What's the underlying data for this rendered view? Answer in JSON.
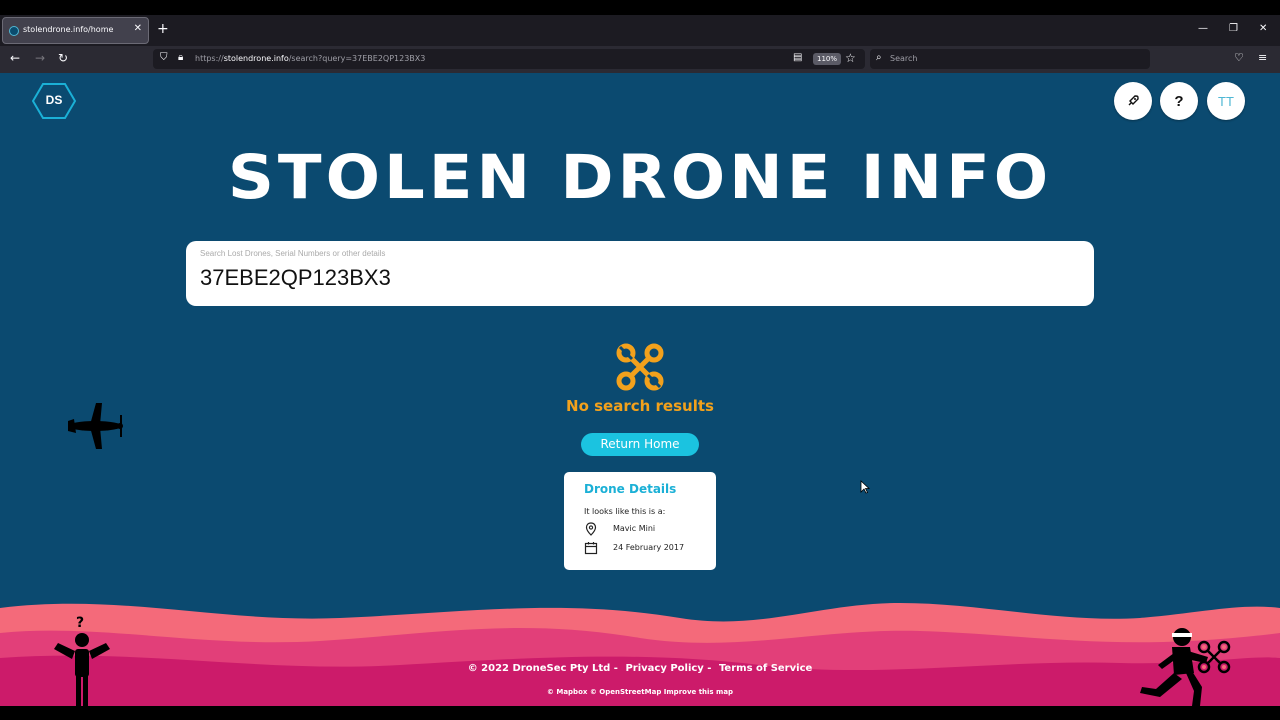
{
  "browser": {
    "tab_title": "stolendrone.info/home",
    "new_tab_symbol": "+",
    "url_prefix": "https://",
    "url_host": "stolendrone.info",
    "url_path": "/search?query=37EBE2QP123BX3",
    "zoom": "110%",
    "search_placeholder": "Search"
  },
  "header": {
    "logo_text": "DS",
    "help_label": "?",
    "user_initials": "TT"
  },
  "hero": {
    "title": "STOLEN DRONE INFO"
  },
  "search": {
    "placeholder": "Search Lost Drones, Serial Numbers or other details",
    "value": "37EBE2QP123BX3"
  },
  "results": {
    "empty_message": "No search results",
    "return_label": "Return Home"
  },
  "drone_details": {
    "title": "Drone Details",
    "subtitle": "It looks like this is a:",
    "model": "Mavic Mini",
    "date": "24 February 2017"
  },
  "footer": {
    "copyright": "© 2022 DroneSec Pty Ltd -",
    "privacy": "Privacy Policy -",
    "terms": "Terms of Service",
    "map_credit": "© Mapbox © OpenStreetMap Improve this map"
  },
  "colors": {
    "page_bg": "#0b4a70",
    "accent_cyan": "#1bc3e0",
    "warning_orange": "#f2a11c"
  }
}
